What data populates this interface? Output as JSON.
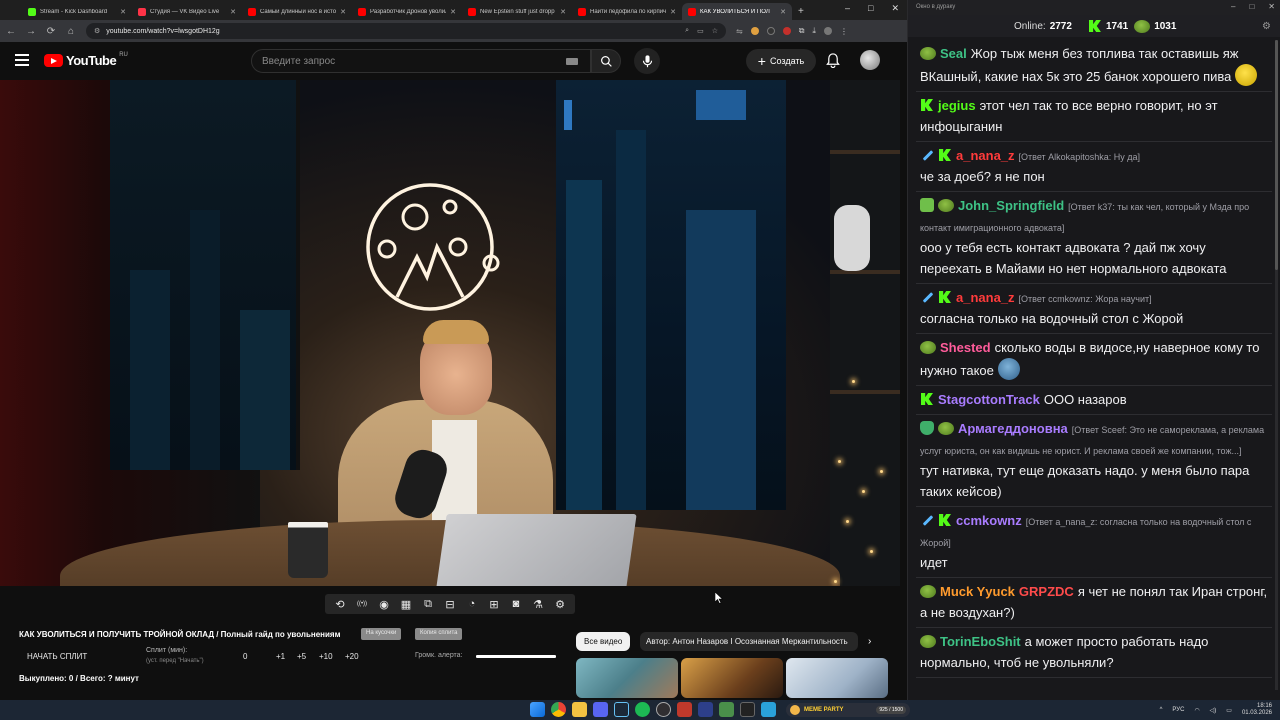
{
  "browser": {
    "tabs": [
      {
        "title": "Stream - Kick Dashboard",
        "icon": "kick-icon",
        "color": "#53fc18"
      },
      {
        "title": "Студия — VK Видео Live",
        "icon": "vk-icon",
        "color": "#ff3347"
      },
      {
        "title": "Самый длинный нос в истор",
        "icon": "youtube-icon",
        "color": "#ff0000"
      },
      {
        "title": "Разработчик Дронов уволил",
        "icon": "youtube-icon",
        "color": "#ff0000"
      },
      {
        "title": "New Epstein stuff just dropp",
        "icon": "youtube-icon",
        "color": "#ff0000"
      },
      {
        "title": "Найти педофила по кирпичу",
        "icon": "youtube-icon",
        "color": "#ff0000"
      },
      {
        "title": "КАК УВОЛИТЬСЯ И ПОЛ",
        "icon": "youtube-icon",
        "color": "#ff0000",
        "active": true
      }
    ],
    "new_tab": "+",
    "url": "youtube.com/watch?v=lwsgotDH12g"
  },
  "youtube": {
    "logo_text": "YouTube",
    "region": "RU",
    "search_placeholder": "Введите запрос",
    "create_label": "Создать"
  },
  "toolbar_icons": [
    "loop-icon",
    "broadcast-icon",
    "eye-icon",
    "film-icon",
    "pip-icon",
    "clapper-icon",
    "speed-icon",
    "add-clip-icon",
    "camera-icon",
    "flask-icon",
    "gear-icon"
  ],
  "video_info": {
    "title": "КАК УВОЛИТЬСЯ И ПОЛУЧИТЬ ТРОЙНОЙ ОКЛАД / Полный гайд по увольнениям",
    "tag1": "На кусочки",
    "tag2": "Копия сплита",
    "split_button": "НАЧАТЬ СПЛИТ",
    "split_label": "Сплит (мин):",
    "split_sub": "(уст. перед \"Начать\")",
    "split_value": "0",
    "increments": [
      "+1",
      "+5",
      "+10",
      "+20"
    ],
    "alert_label": "Громк. алерта:",
    "alert_volume": 1.0,
    "bought": "Выкуплено: 0 / Всего: ? минут"
  },
  "chips": {
    "all": "Все видео",
    "author": "Автор: Антон Назаров I Осознанная Меркантильность"
  },
  "chat": {
    "window_title": "Окно в дураку",
    "online_label": "Online:",
    "online_count": "2772",
    "kick_count": "1741",
    "pepe_count": "1031",
    "messages": [
      {
        "badges": [
          "pepe"
        ],
        "user": "Seal",
        "color": "#3ec286",
        "reply": "",
        "text": "Жор тыж меня без топлива так оставишь яж ВКашный, какие нах 5к это 25 банок хорошего пива",
        "emote": true
      },
      {
        "badges": [
          "kick"
        ],
        "user": "jegius",
        "color": "#53fc18",
        "reply": "",
        "text": "этот чел так то все верно говорит, но эт инфоцыганин",
        "emote": false
      },
      {
        "badges": [
          "sword",
          "kick"
        ],
        "user": "a_nana_z",
        "color": "#ff3b3b",
        "reply": "[Ответ Alkokapitoshka: Ну да]",
        "text": "че за доеб? я не пон",
        "emote": false
      },
      {
        "badges": [
          "check",
          "pepe"
        ],
        "user": "John_Springfield",
        "color": "#3ec286",
        "reply": "[Ответ k37: ты как чел, который у Мэда про контакт имиграционного адвоката]",
        "text": "ооо у тебя есть контакт адвоката ? дай пж хочу переехать в Майами но нет нормального адвоката",
        "emote": false
      },
      {
        "badges": [
          "sword",
          "kick"
        ],
        "user": "a_nana_z",
        "color": "#ff3b3b",
        "reply": "[Ответ ccmkownz: Жора научит]",
        "text": "согласна только на водочный стол с Жорой",
        "emote": false
      },
      {
        "badges": [
          "pepe"
        ],
        "user": "Shested",
        "color": "#ff5c9b",
        "reply": "",
        "text": "сколько воды в видосе,ну наверное кому то нужно такое",
        "emote": true
      },
      {
        "badges": [
          "kick"
        ],
        "user": "StagcottonTrack",
        "color": "#a97cff",
        "reply": "",
        "text": "ООО назаров",
        "emote": false
      },
      {
        "badges": [
          "shield",
          "pepe"
        ],
        "user": "Армагеддоновна",
        "color": "#a97cff",
        "reply": "[Ответ Sceef: Это не самореклама, а реклама услуг юриста, он как видишь не юрист. И реклама своей же компании, тож...]",
        "text": "тут нативка, тут еще доказать надо. у меня было пара таких кейсов)",
        "emote": false
      },
      {
        "badges": [
          "sword",
          "kick"
        ],
        "user": "ccmkownz",
        "color": "#a97cff",
        "reply": "[Ответ a_nana_z: согласна только на водочный стол с Жорой]",
        "text": "идет",
        "emote": false
      },
      {
        "badges": [
          "pepe"
        ],
        "user": "Muck Yyuck",
        "color": "#ff9b2e",
        "user2": "GRPZDC",
        "reply": "",
        "text": "я чет не понял так Иран стронг, а не воздухан?)",
        "emote": false
      },
      {
        "badges": [
          "pepe"
        ],
        "user": "TorinEboShit",
        "color": "#3ec286",
        "reply": "",
        "text": "а может просто работать надо нормально, чтоб не увольняли?",
        "emote": false
      }
    ]
  },
  "taskbar": {
    "game_name": "MEME PARTY",
    "game_progress": "925 / 1500",
    "lang": "РУС",
    "time": "18:16",
    "date": "01.03.2026"
  }
}
